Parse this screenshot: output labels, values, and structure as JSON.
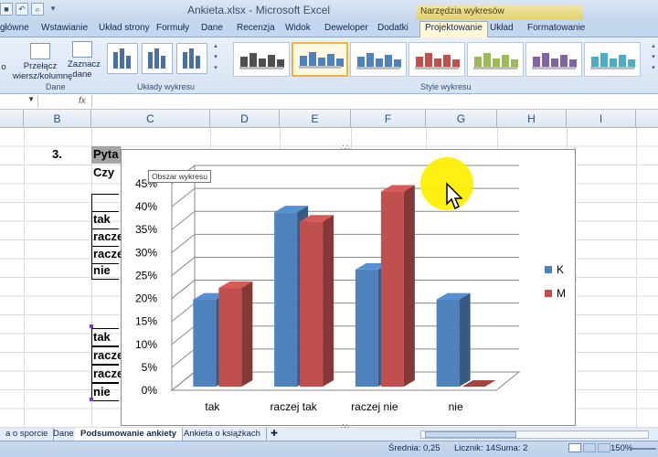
{
  "window": {
    "title": "Ankieta.xlsx - Microsoft Excel",
    "context_title": "Narzędzia wykresów"
  },
  "ribbon_tabs": [
    {
      "label": "główne"
    },
    {
      "label": "Wstawianie"
    },
    {
      "label": "Układ strony"
    },
    {
      "label": "Formuły"
    },
    {
      "label": "Dane"
    },
    {
      "label": "Recenzja"
    },
    {
      "label": "Widok"
    },
    {
      "label": "Deweloper"
    },
    {
      "label": "Dodatki"
    },
    {
      "label": "Projektowanie",
      "active": true
    },
    {
      "label": "Układ"
    },
    {
      "label": "Formatowanie"
    }
  ],
  "ribbon": {
    "switch_label_1": "Przełącz",
    "switch_label_2": "wiersz/kolumnę",
    "select_label_1": "Zaznacz",
    "select_label_2": "dane",
    "group_data": "Dane",
    "group_layouts": "Układy wykresu",
    "group_styles": "Style wykresu",
    "styles": [
      {
        "color": "#4f4f4f"
      },
      {
        "color": "#4f81bd"
      },
      {
        "color": "#4f81bd"
      },
      {
        "color": "#c0504d"
      },
      {
        "color": "#9bbb59"
      },
      {
        "color": "#8064a2"
      },
      {
        "color": "#4bacc6"
      }
    ]
  },
  "formula_bar": {
    "fx": "fx"
  },
  "columns": [
    "B",
    "C",
    "D",
    "E",
    "F",
    "G",
    "H",
    "I"
  ],
  "cells": {
    "number": "3.",
    "question": "Pyta",
    "question2": "Czy",
    "rows1": [
      "tak",
      "racze",
      "racze",
      "nie"
    ],
    "rows2": [
      "tak",
      "racze",
      "racze",
      "nie"
    ]
  },
  "tooltip": "Obszar wykresu",
  "chart_data": {
    "type": "bar",
    "categories": [
      "tak",
      "raczej tak",
      "raczej nie",
      "nie"
    ],
    "series": [
      {
        "name": "K",
        "values": [
          0.19,
          0.38,
          0.255,
          0.19
        ],
        "color": "#4f81bd"
      },
      {
        "name": "M",
        "values": [
          0.215,
          0.36,
          0.425,
          0.0
        ],
        "color": "#c0504d"
      }
    ],
    "ylim": [
      0,
      0.45
    ],
    "yticks": [
      "0%",
      "5%",
      "10%",
      "15%",
      "20%",
      "25%",
      "30%",
      "35%",
      "40%",
      "45%"
    ],
    "grid": true,
    "legend": "right"
  },
  "sheet_tabs": [
    "a o sporcie",
    "Dane",
    "Podsumowanie ankiety",
    "Ankieta o książkach"
  ],
  "active_sheet": "Podsumowanie ankiety",
  "status": {
    "average": "Średnia: 0,25",
    "count": "Licznik: 14",
    "sum": "Suma: 2",
    "zoom": "150%"
  }
}
